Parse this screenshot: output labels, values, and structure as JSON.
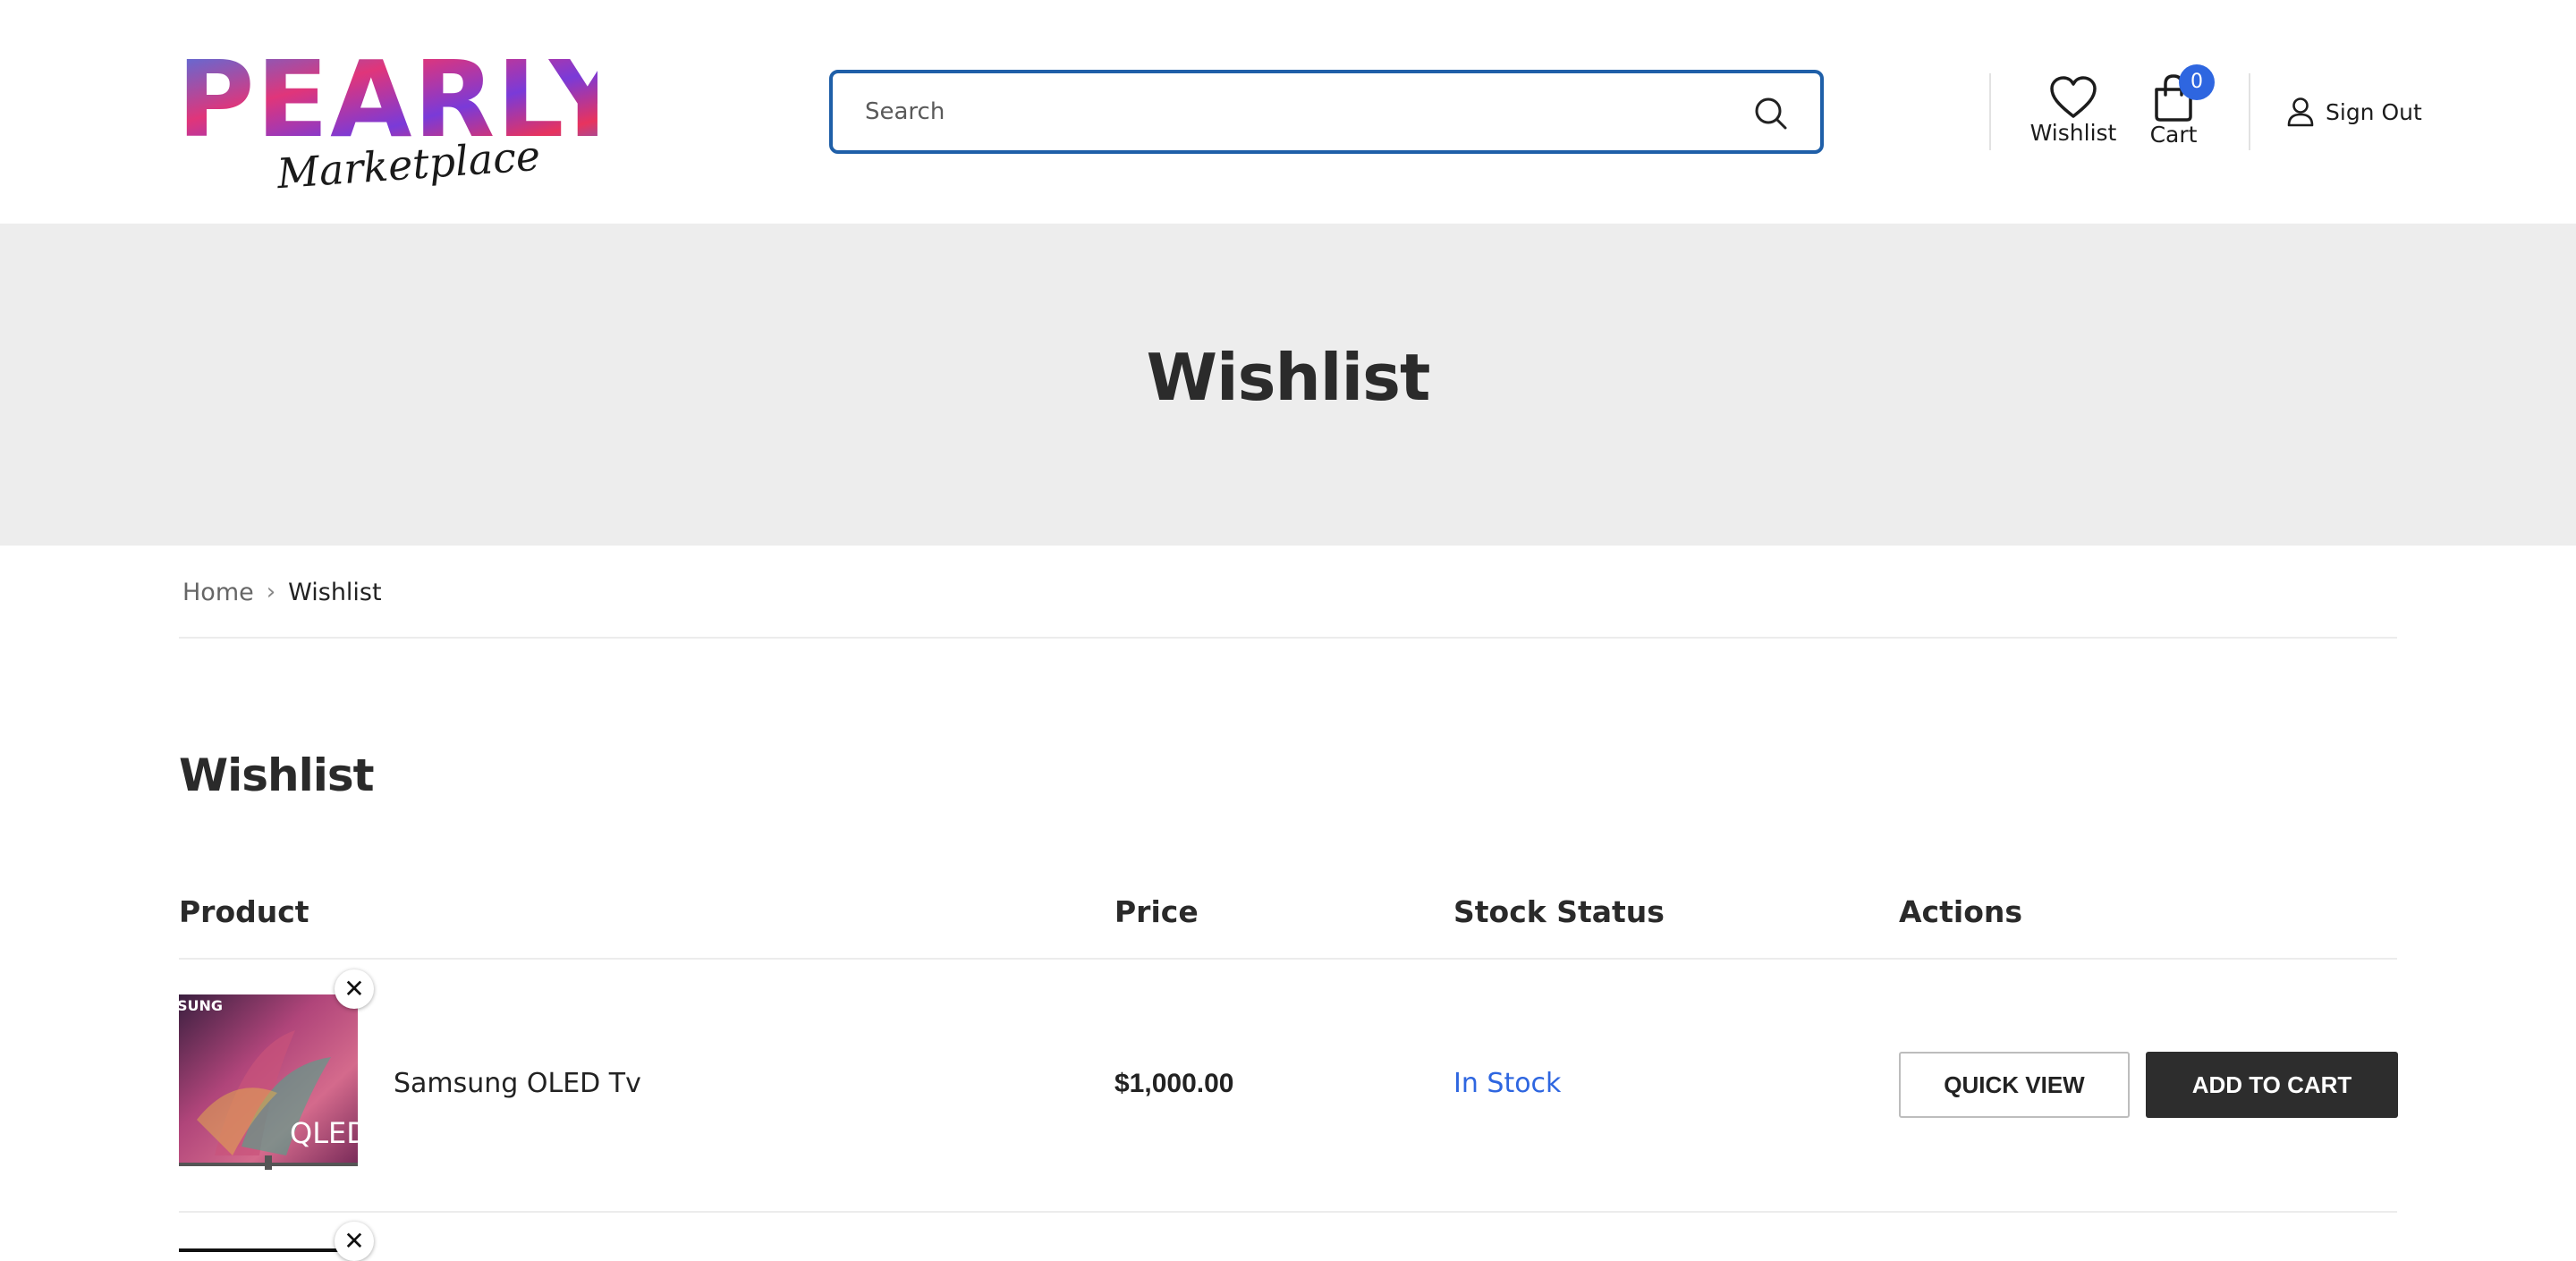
{
  "header": {
    "logo": {
      "brand": "PEARLY",
      "tagline": "Marketplace"
    },
    "search": {
      "placeholder": "Search",
      "value": ""
    },
    "wishlist_label": "Wishlist",
    "cart_label": "Cart",
    "cart_count": "0",
    "signout_label": "Sign Out",
    "icons": {
      "search": "search-icon",
      "wishlist": "heart-icon",
      "cart": "shopping-bag-icon",
      "account": "user-icon"
    }
  },
  "banner": {
    "title": "Wishlist"
  },
  "breadcrumb": {
    "home": "Home",
    "separator": "›",
    "current": "Wishlist"
  },
  "main": {
    "title": "Wishlist",
    "table": {
      "headers": {
        "product": "Product",
        "price": "Price",
        "stock": "Stock Status",
        "actions": "Actions"
      },
      "rows": [
        {
          "name": "Samsung OLED Tv",
          "price": "$1,000.00",
          "stock": "In Stock",
          "quick_view": "QUICK VIEW",
          "add_to_cart": "ADD TO CART",
          "image_text": {
            "top": "SUNG",
            "bottom": "QLED"
          }
        }
      ]
    }
  },
  "colors": {
    "accent": "#1f5fa8",
    "badge": "#2e66e0",
    "in_stock": "#2e66e0",
    "banner_bg": "#ededed",
    "dark_button": "#2d2d2d"
  }
}
